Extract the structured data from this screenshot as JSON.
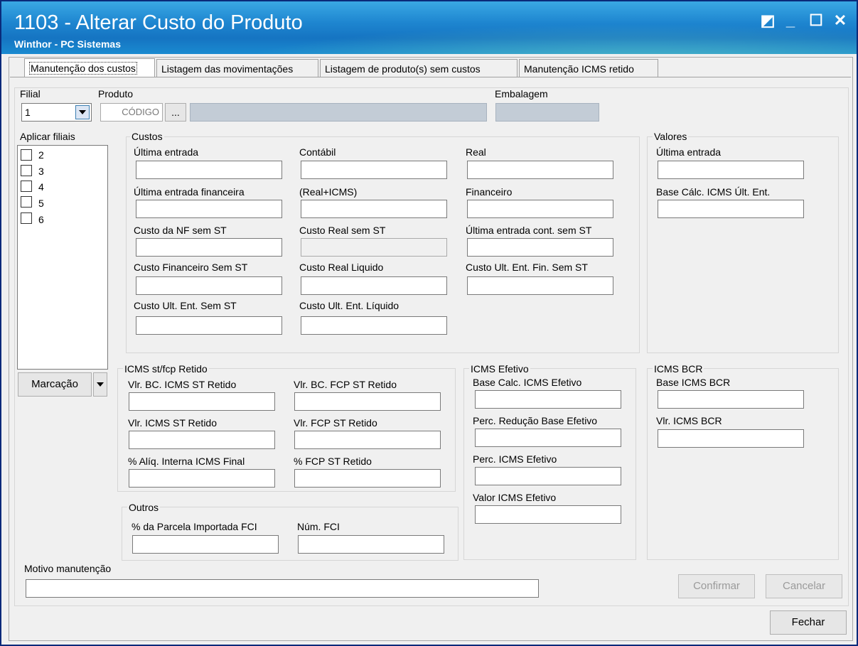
{
  "window": {
    "title": "1103 - Alterar Custo do Produto",
    "subtitle": "Winthor - PC Sistemas",
    "restore_glyph": "◩",
    "minimize_glyph": "_",
    "maximize_glyph": "☐",
    "close_glyph": "✕"
  },
  "tabs": [
    {
      "label": "Manutenção dos custos",
      "active": true
    },
    {
      "label": "Listagem das movimentações"
    },
    {
      "label": "Listagem de produto(s)  sem custos"
    },
    {
      "label": "Manutenção ICMS retido"
    }
  ],
  "header": {
    "filial_label": "Filial",
    "filial_value": "1",
    "produto_label": "Produto",
    "produto_placeholder": "CÓDIGO",
    "browse_label": "...",
    "embalagem_label": "Embalagem"
  },
  "filiais": {
    "label": "Aplicar filiais",
    "items": [
      "2",
      "3",
      "4",
      "5",
      "6"
    ],
    "marcacao_label": "Marcação"
  },
  "custos": {
    "group_label": "Custos",
    "col1": [
      "Última entrada",
      "Última entrada financeira",
      "Custo da NF sem ST",
      "Custo Financeiro Sem ST",
      "Custo Ult. Ent. Sem ST"
    ],
    "col2": [
      "Contábil",
      "(Real+ICMS)",
      "Custo Real sem ST",
      "Custo Real Liquido",
      "Custo Ult. Ent. Líquido"
    ],
    "col3": [
      "Real",
      "Financeiro",
      "Última entrada cont. sem ST",
      "Custo Ult. Ent. Fin. Sem ST"
    ]
  },
  "valores": {
    "group_label": "Valores",
    "fields": [
      "Última entrada",
      "Base Cálc. ICMS Últ. Ent."
    ]
  },
  "icms_st": {
    "group_label": "ICMS st/fcp Retido",
    "col1": [
      "Vlr. BC. ICMS ST Retido",
      "Vlr. ICMS ST Retido",
      "% Alíq. Interna ICMS Final"
    ],
    "col2": [
      "Vlr. BC. FCP ST Retido",
      "Vlr. FCP ST Retido",
      "% FCP ST Retido"
    ]
  },
  "outros": {
    "group_label": "Outros",
    "fields": [
      "% da Parcela Importada FCI",
      "Núm. FCI"
    ]
  },
  "icms_efetivo": {
    "group_label": "ICMS Efetivo",
    "fields": [
      "Base Calc. ICMS Efetivo",
      "Perc. Redução Base Efetivo",
      "Perc. ICMS Efetivo",
      "Valor ICMS Efetivo"
    ]
  },
  "icms_bcr": {
    "group_label": "ICMS BCR",
    "fields": [
      "Base ICMS BCR",
      "Vlr. ICMS BCR"
    ]
  },
  "footer": {
    "motivo_label": "Motivo manutenção",
    "confirmar_label": "Confirmar",
    "cancelar_label": "Cancelar",
    "fechar_label": "Fechar"
  }
}
